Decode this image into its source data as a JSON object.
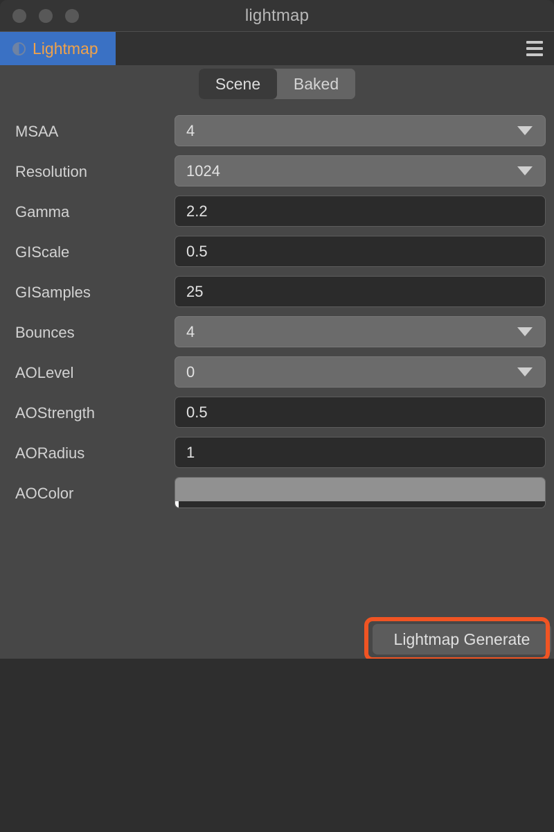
{
  "window": {
    "title": "lightmap",
    "controls": [
      "close",
      "minimize",
      "maximize"
    ]
  },
  "tabbar": {
    "tab_label": "Lightmap",
    "tab_icon": "half-circle-icon",
    "menu_icon": "hamburger-menu-icon"
  },
  "segmented": {
    "options": [
      {
        "label": "Scene",
        "selected": true
      },
      {
        "label": "Baked",
        "selected": false
      }
    ]
  },
  "form": {
    "rows": [
      {
        "label": "MSAA",
        "type": "select",
        "value": "4"
      },
      {
        "label": "Resolution",
        "type": "select",
        "value": "1024"
      },
      {
        "label": "Gamma",
        "type": "input",
        "value": "2.2"
      },
      {
        "label": "GIScale",
        "type": "input",
        "value": "0.5"
      },
      {
        "label": "GISamples",
        "type": "input",
        "value": "25"
      },
      {
        "label": "Bounces",
        "type": "select",
        "value": "4"
      },
      {
        "label": "AOLevel",
        "type": "select",
        "value": "0"
      },
      {
        "label": "AOStrength",
        "type": "input",
        "value": "0.5"
      },
      {
        "label": "AORadius",
        "type": "input",
        "value": "1"
      },
      {
        "label": "AOColor",
        "type": "color",
        "value": "#919191"
      }
    ]
  },
  "actions": {
    "generate_label": "Lightmap Generate"
  },
  "colors": {
    "tab_active": "#3a71c4",
    "tab_text": "#f0a24a",
    "panel_bg": "#474747",
    "titlebar_bg": "#353535",
    "tabbar_bg": "#323232",
    "bottom_bg": "#2e2e2e",
    "select_bg": "#6b6b6b",
    "input_bg": "#2b2b2b",
    "highlight": "#f05423",
    "aocolor_swatch": "#919191"
  }
}
